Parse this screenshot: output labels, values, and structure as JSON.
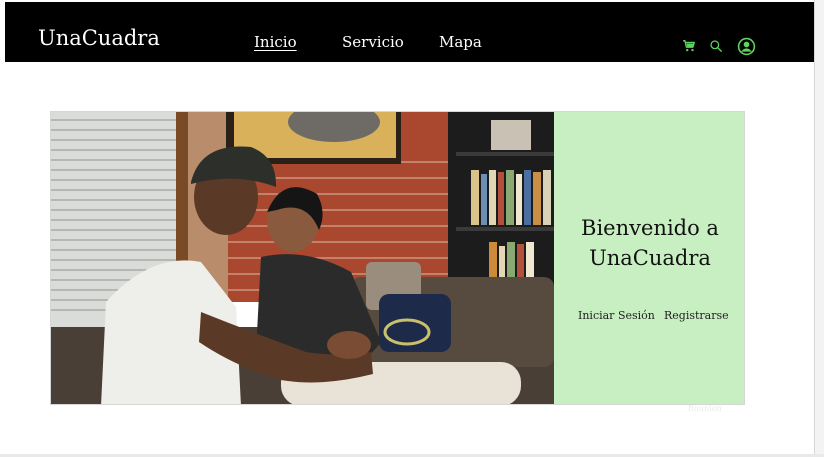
{
  "brand": "UnaCuadra",
  "nav": {
    "items": [
      {
        "label": "Inicio",
        "active": true
      },
      {
        "label": "Servicio",
        "active": false
      },
      {
        "label": "Mapa",
        "active": false
      }
    ],
    "icons": [
      "cart-icon",
      "search-icon",
      "user-icon"
    ],
    "icon_color": "#5fd35f"
  },
  "hero": {
    "photo_description": "couple-on-sofa-photo",
    "panel_color": "#c8efc1",
    "welcome_line1": "Bienvenido a",
    "welcome_line2": "UnaCuadra",
    "login_label": "Iniciar Sesión",
    "register_label": "Registrarse"
  },
  "faint_text": "Rounion"
}
